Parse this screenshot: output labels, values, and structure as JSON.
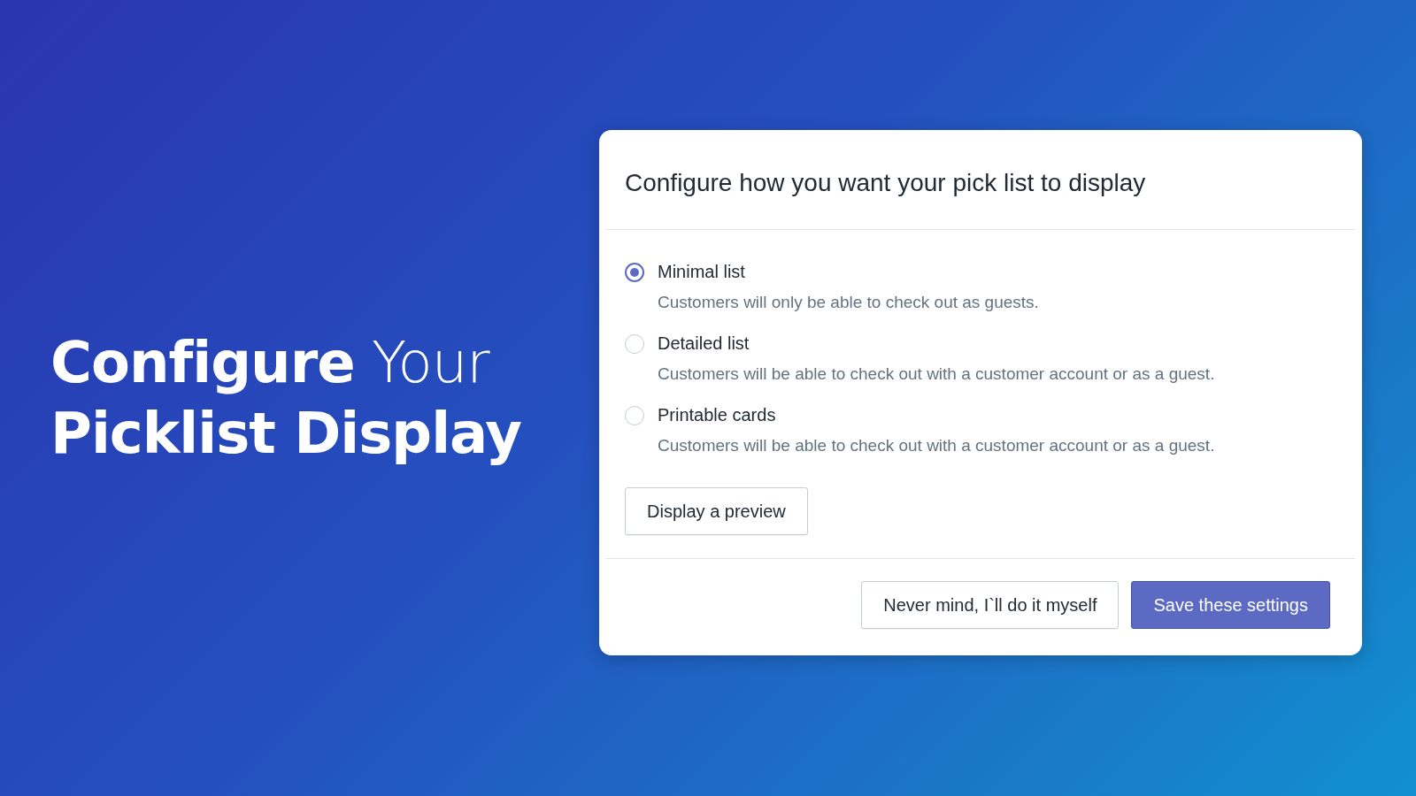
{
  "headline": {
    "line_1": "**Configure** Your",
    "line_2": "Picklist Display"
  },
  "dialog": {
    "title": "Configure how you want your pick list to display",
    "options": [
      {
        "label": "Minimal list",
        "description": "Customers will only be able to check out as guests.",
        "selected": true
      },
      {
        "label": "Detailed list",
        "description": "Customers will be able to check out with a customer account or as a guest.",
        "selected": false
      },
      {
        "label": "Printable cards",
        "description": "Customers will be able to check out with a customer account or as a guest.",
        "selected": false
      }
    ],
    "preview_button": "Display a preview",
    "buttons": [
      {
        "label": "Never mind, I`ll do it myself",
        "kind": "secondary"
      },
      {
        "label": "Save these settings",
        "kind": "primary"
      }
    ]
  }
}
